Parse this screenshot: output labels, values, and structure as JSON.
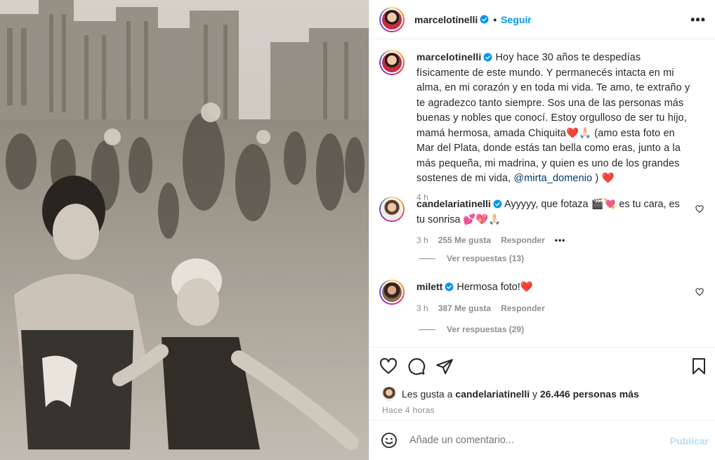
{
  "post": {
    "author": "marcelotinelli",
    "follow_label": "Seguir",
    "dot": "•",
    "more_label": "•••"
  },
  "caption": {
    "username": "marcelotinelli",
    "text_before_mention": "Hoy hace 30 años te despedías físicamente de este mundo. Y permanecés intacta en mi alma, en mi corazón y en toda mi vida. Te amo, te extraño y te agradezco tanto siempre. Sos una de las personas más buenas y nobles que conocí. Estoy orgulloso de ser tu hijo, mamá hermosa, amada Chiquita❤️🙏🏻 (amo esta foto en Mar del Plata, donde estás tan bella como eras, junto a la más pequeña, mi madrina, y quien es uno de los grandes sostenes de mi vida,",
    "mention": "@mirta_domenio",
    "text_after_mention": ") ❤️",
    "time": "4 h"
  },
  "comments": [
    {
      "username": "candelariatinelli",
      "text": "Ayyyyy, que fotaza 🎬💘 es tu cara, es tu sonrisa 💕💖🙏🏻",
      "time": "3 h",
      "likes": "255 Me gusta",
      "reply_label": "Responder",
      "options_label": "•••",
      "view_replies": "Ver respuestas (13)"
    },
    {
      "username": "milett",
      "text": "Hermosa foto!❤️",
      "time": "3 h",
      "likes": "387 Me gusta",
      "reply_label": "Responder",
      "view_replies": "Ver respuestas (29)"
    }
  ],
  "likes_line": {
    "prefix": "Les gusta a",
    "user": "candelariatinelli",
    "connector": "y",
    "others": "26.446 personas más"
  },
  "posted_ago": "Hace 4 horas",
  "add_comment": {
    "placeholder": "Añade un comentario...",
    "publish_label": "Publicar"
  },
  "icons": [
    "verified-badge-icon",
    "more-options-icon",
    "heart-icon",
    "comment-icon",
    "share-icon",
    "bookmark-icon",
    "emoji-icon"
  ],
  "colors": {
    "link_blue": "#0095f6",
    "publish_disabled": "#b2dffc",
    "meta_gray": "#8e8e8e",
    "mention": "#00376b"
  }
}
